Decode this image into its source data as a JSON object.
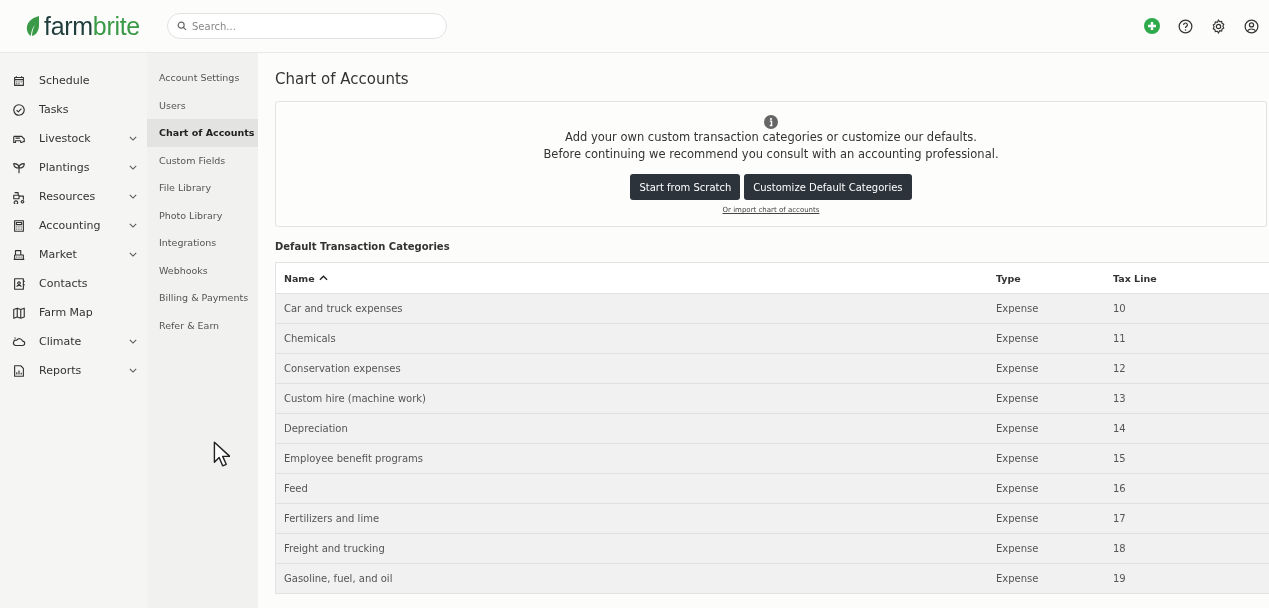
{
  "logo": {
    "part_1": "farm",
    "part_2": "brite"
  },
  "search": {
    "placeholder": "Search..."
  },
  "sidebar": {
    "items": [
      {
        "label": "Schedule",
        "expandable": false
      },
      {
        "label": "Tasks",
        "expandable": false
      },
      {
        "label": "Livestock",
        "expandable": true
      },
      {
        "label": "Plantings",
        "expandable": true
      },
      {
        "label": "Resources",
        "expandable": true
      },
      {
        "label": "Accounting",
        "expandable": true
      },
      {
        "label": "Market",
        "expandable": true
      },
      {
        "label": "Contacts",
        "expandable": false
      },
      {
        "label": "Farm Map",
        "expandable": false
      },
      {
        "label": "Climate",
        "expandable": true
      },
      {
        "label": "Reports",
        "expandable": true
      }
    ]
  },
  "settings_menu": {
    "items": [
      {
        "label": "Account Settings",
        "selected": false
      },
      {
        "label": "Users",
        "selected": false
      },
      {
        "label": "Chart of Accounts",
        "selected": true
      },
      {
        "label": "Custom Fields",
        "selected": false
      },
      {
        "label": "File Library",
        "selected": false
      },
      {
        "label": "Photo Library",
        "selected": false
      },
      {
        "label": "Integrations",
        "selected": false
      },
      {
        "label": "Webhooks",
        "selected": false
      },
      {
        "label": "Billing & Payments",
        "selected": false
      },
      {
        "label": "Refer & Earn",
        "selected": false
      }
    ]
  },
  "page_title": "Chart of Accounts",
  "notice": {
    "lines": [
      "Add your own custom transaction categories or customize our defaults.",
      "Before continuing we recommend you consult with an accounting professional."
    ],
    "buttons": [
      "Start from Scratch",
      "Customize Default Categories"
    ],
    "link": "Or import chart of accounts"
  },
  "section_title": "Default Transaction Categories",
  "table": {
    "columns": [
      {
        "label": "Name",
        "sorted": true
      },
      {
        "label": "Type",
        "sorted": false
      },
      {
        "label": "Tax Line",
        "sorted": false
      }
    ],
    "rows": [
      [
        "Car and truck expenses",
        "Expense",
        "10"
      ],
      [
        "Chemicals",
        "Expense",
        "11"
      ],
      [
        "Conservation expenses",
        "Expense",
        "12"
      ],
      [
        "Custom hire (machine work)",
        "Expense",
        "13"
      ],
      [
        "Depreciation",
        "Expense",
        "14"
      ],
      [
        "Employee benefit programs",
        "Expense",
        "15"
      ],
      [
        "Feed",
        "Expense",
        "16"
      ],
      [
        "Fertilizers and lime",
        "Expense",
        "17"
      ],
      [
        "Freight and trucking",
        "Expense",
        "18"
      ],
      [
        "Gasoline, fuel, and oil",
        "Expense",
        "19"
      ]
    ]
  }
}
